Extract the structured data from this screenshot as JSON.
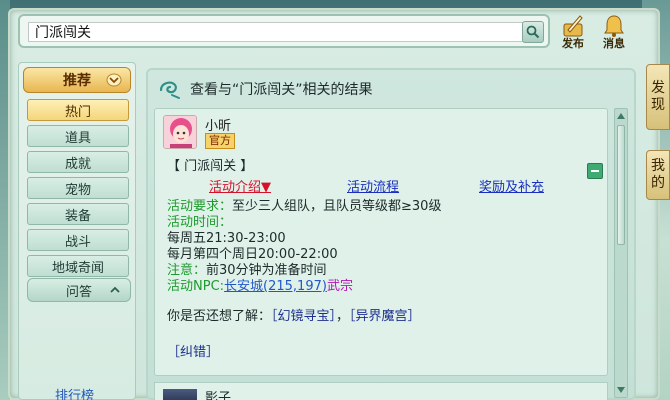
{
  "search": {
    "query": "门派闯关"
  },
  "top_buttons": {
    "publish_label": "发布",
    "message_label": "消息"
  },
  "side_tabs": {
    "discover": [
      "发",
      "现"
    ],
    "mine": [
      "我",
      "的"
    ]
  },
  "nav": {
    "recommend_label": "推荐",
    "items": [
      {
        "label": "热门",
        "active": true
      },
      {
        "label": "道具",
        "active": false
      },
      {
        "label": "成就",
        "active": false
      },
      {
        "label": "宠物",
        "active": false
      },
      {
        "label": "装备",
        "active": false
      },
      {
        "label": "战斗",
        "active": false
      },
      {
        "label": "地域奇闻",
        "active": false
      }
    ],
    "qa_label": "问答",
    "rank_link": "排行榜"
  },
  "results": {
    "title": "查看与“门派闯关”相关的结果",
    "card": {
      "poster_name": "小昕",
      "badge": "官方",
      "topic": "【 门派闯关 】",
      "links": {
        "intro": "活动介绍▼",
        "flow": "活动流程",
        "reward": "奖励及补充"
      },
      "requirement_label": "活动要求：",
      "requirement_value": "至少三人组队，且队员等级都≥30级",
      "time_label": "活动时间：",
      "time_line_1": "每周五21:30-23:00",
      "time_line_2": "每月第四个周日20:00-22:00",
      "note_label": "注意：",
      "note_value": "前30分钟为准备时间",
      "npc_label": "活动NPC:",
      "npc_location": "长安城(215,197)",
      "npc_name": "武宗",
      "also_prefix": "你是否还想了解：",
      "also_1": "［幻镜寻宝］",
      "also_sep": "，",
      "also_2": "［异界魔宫］",
      "correction": "［纠错］"
    },
    "next_card": {
      "poster_name": "影子"
    }
  },
  "colors": {
    "accent_gold": "#f4d67a",
    "link_red": "#d8112a",
    "link_blue": "#1a2fbf",
    "label_green": "#1d9b2d",
    "npc_purple": "#b314b3"
  }
}
